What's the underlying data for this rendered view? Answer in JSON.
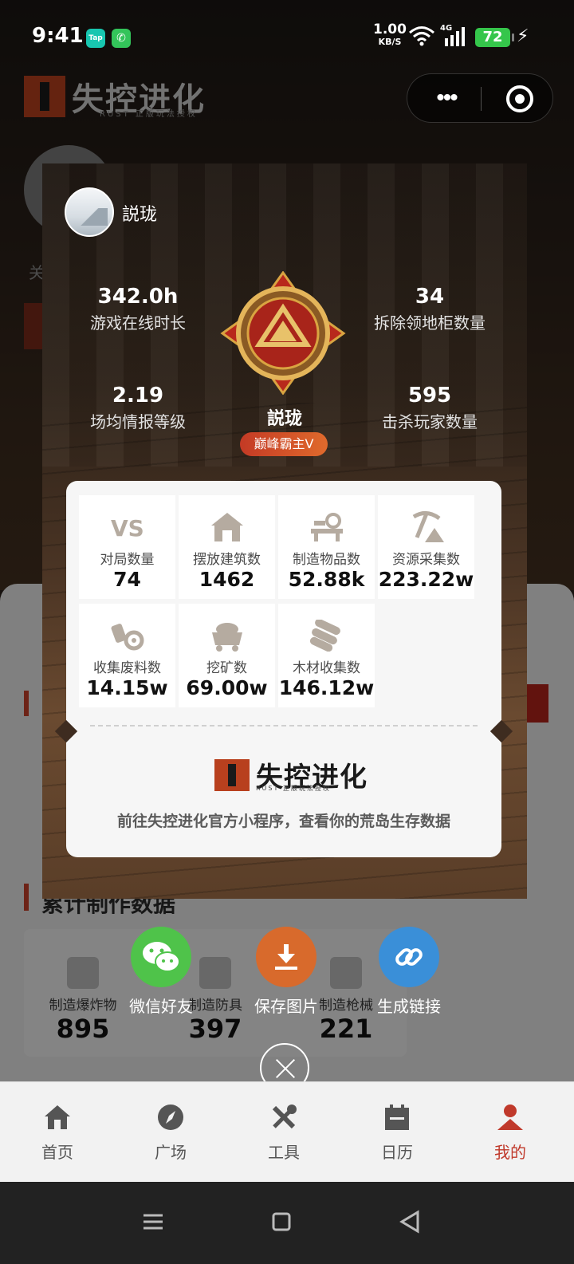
{
  "status_bar": {
    "time": "9:41",
    "tap_label": "Tap",
    "speed_value": "1.00",
    "speed_unit": "KB/S",
    "network": "4G",
    "battery": "72"
  },
  "background": {
    "logo_name": "失控进化",
    "logo_sub": "RUST 正版玩法授权",
    "blurred_text": "关",
    "section_title": "累计制作数据",
    "craft": [
      {
        "label": "制造爆炸物",
        "value": "895"
      },
      {
        "label": "制造防具",
        "value": "397"
      },
      {
        "label": "制造枪械",
        "value": "221"
      }
    ]
  },
  "card": {
    "username": "説珑",
    "stats_top_left": {
      "value": "342.0h",
      "label": "游戏在线时长"
    },
    "stats_top_right": {
      "value": "34",
      "label": "拆除领地柜数量"
    },
    "stats_bottom_left": {
      "value": "2.19",
      "label": "场均情报等级"
    },
    "stats_bottom_right": {
      "value": "595",
      "label": "击杀玩家数量"
    },
    "player_name": "説珑",
    "rank": "巅峰霸主V",
    "grid": [
      {
        "icon": "vs-icon",
        "label": "对局数量",
        "value": "74"
      },
      {
        "icon": "house-icon",
        "label": "摆放建筑数",
        "value": "1462"
      },
      {
        "icon": "workbench-icon",
        "label": "制造物品数",
        "value": "52.88k"
      },
      {
        "icon": "pickaxe-icon",
        "label": "资源采集数",
        "value": "223.22w"
      },
      {
        "icon": "scrap-icon",
        "label": "收集废料数",
        "value": "14.15w"
      },
      {
        "icon": "minecart-icon",
        "label": "挖矿数",
        "value": "69.00w"
      },
      {
        "icon": "logs-icon",
        "label": "木材收集数",
        "value": "146.12w"
      }
    ],
    "logo_name": "失控进化",
    "logo_sub": "RUST 正版玩法授权",
    "cta": "前往失控进化官方小程序，查看你的荒岛生存数据"
  },
  "share_actions": [
    {
      "label": "微信好友",
      "color": "#4fc34a",
      "icon": "wechat-icon"
    },
    {
      "label": "保存图片",
      "color": "#d86a2c",
      "icon": "download-icon"
    },
    {
      "label": "生成链接",
      "color": "#3a8fd8",
      "icon": "link-icon"
    }
  ],
  "tabs": [
    {
      "label": "首页",
      "icon": "home-icon"
    },
    {
      "label": "广场",
      "icon": "compass-icon"
    },
    {
      "label": "工具",
      "icon": "tools-icon"
    },
    {
      "label": "日历",
      "icon": "calendar-icon"
    },
    {
      "label": "我的",
      "icon": "profile-icon",
      "active": true
    }
  ],
  "colors": {
    "accent": "#c0392b",
    "brand": "#b8401e"
  }
}
